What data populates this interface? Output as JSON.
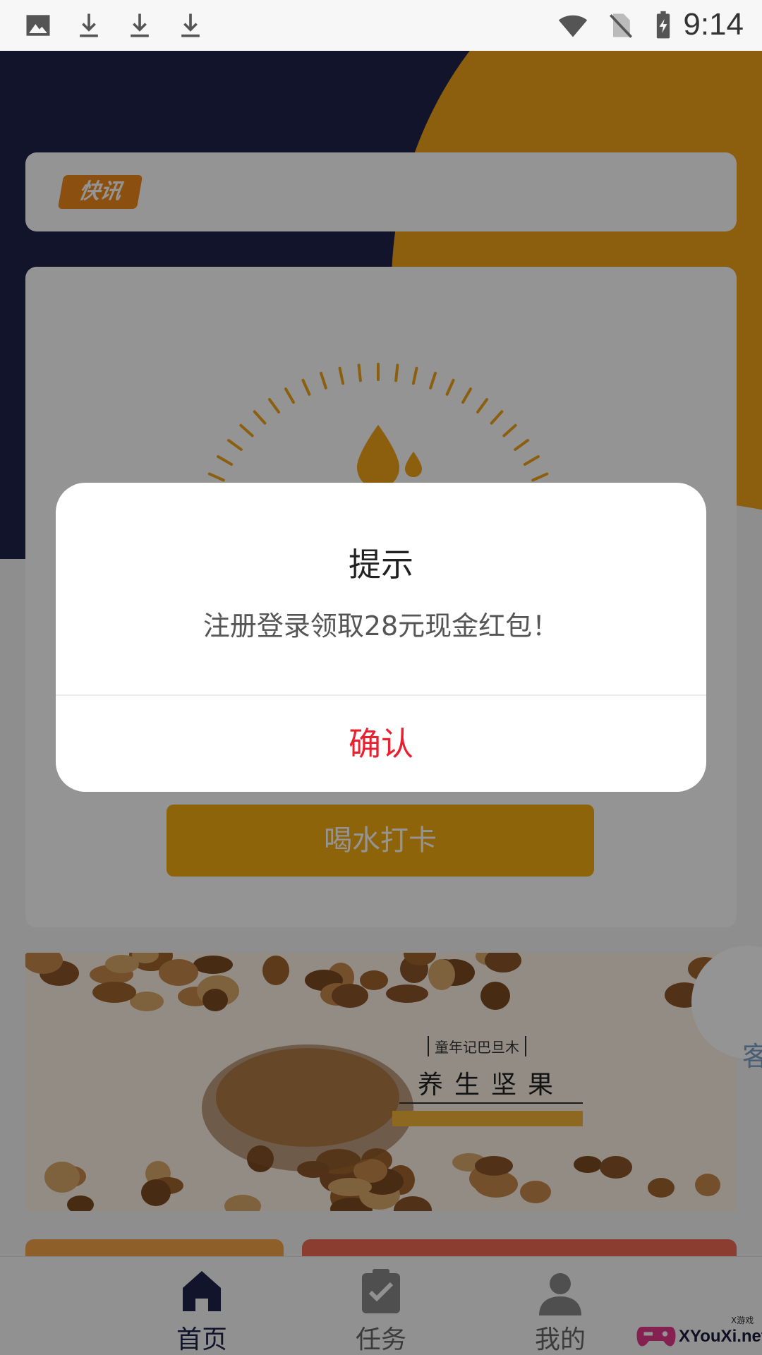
{
  "status_bar": {
    "time": "9:14",
    "left_icons": [
      "image-icon",
      "download-icon",
      "download-icon",
      "download-icon"
    ],
    "right_icons": [
      "wifi-icon",
      "no-sim-icon",
      "battery-charging-icon"
    ]
  },
  "news": {
    "badge": "快讯"
  },
  "main": {
    "checkin_button": "喝水打卡"
  },
  "banner": {
    "brand": "童年记巴旦木",
    "title": "养生坚果"
  },
  "service": {
    "label": "客"
  },
  "tabs": [
    {
      "label": "首页",
      "icon": "home-icon",
      "active": true
    },
    {
      "label": "任务",
      "icon": "task-check-icon",
      "active": false
    },
    {
      "label": "我的",
      "icon": "person-icon",
      "active": false
    }
  ],
  "watermark": {
    "text": "XYouXi.net",
    "small": "X游戏"
  },
  "dialog": {
    "title": "提示",
    "message": "注册登录领取28元现金红包！",
    "confirm": "确认"
  },
  "colors": {
    "navy": "#1e2449",
    "orange": "#f0a419",
    "confirm_red": "#e8202f",
    "button_yellow": "#f5ad12"
  }
}
